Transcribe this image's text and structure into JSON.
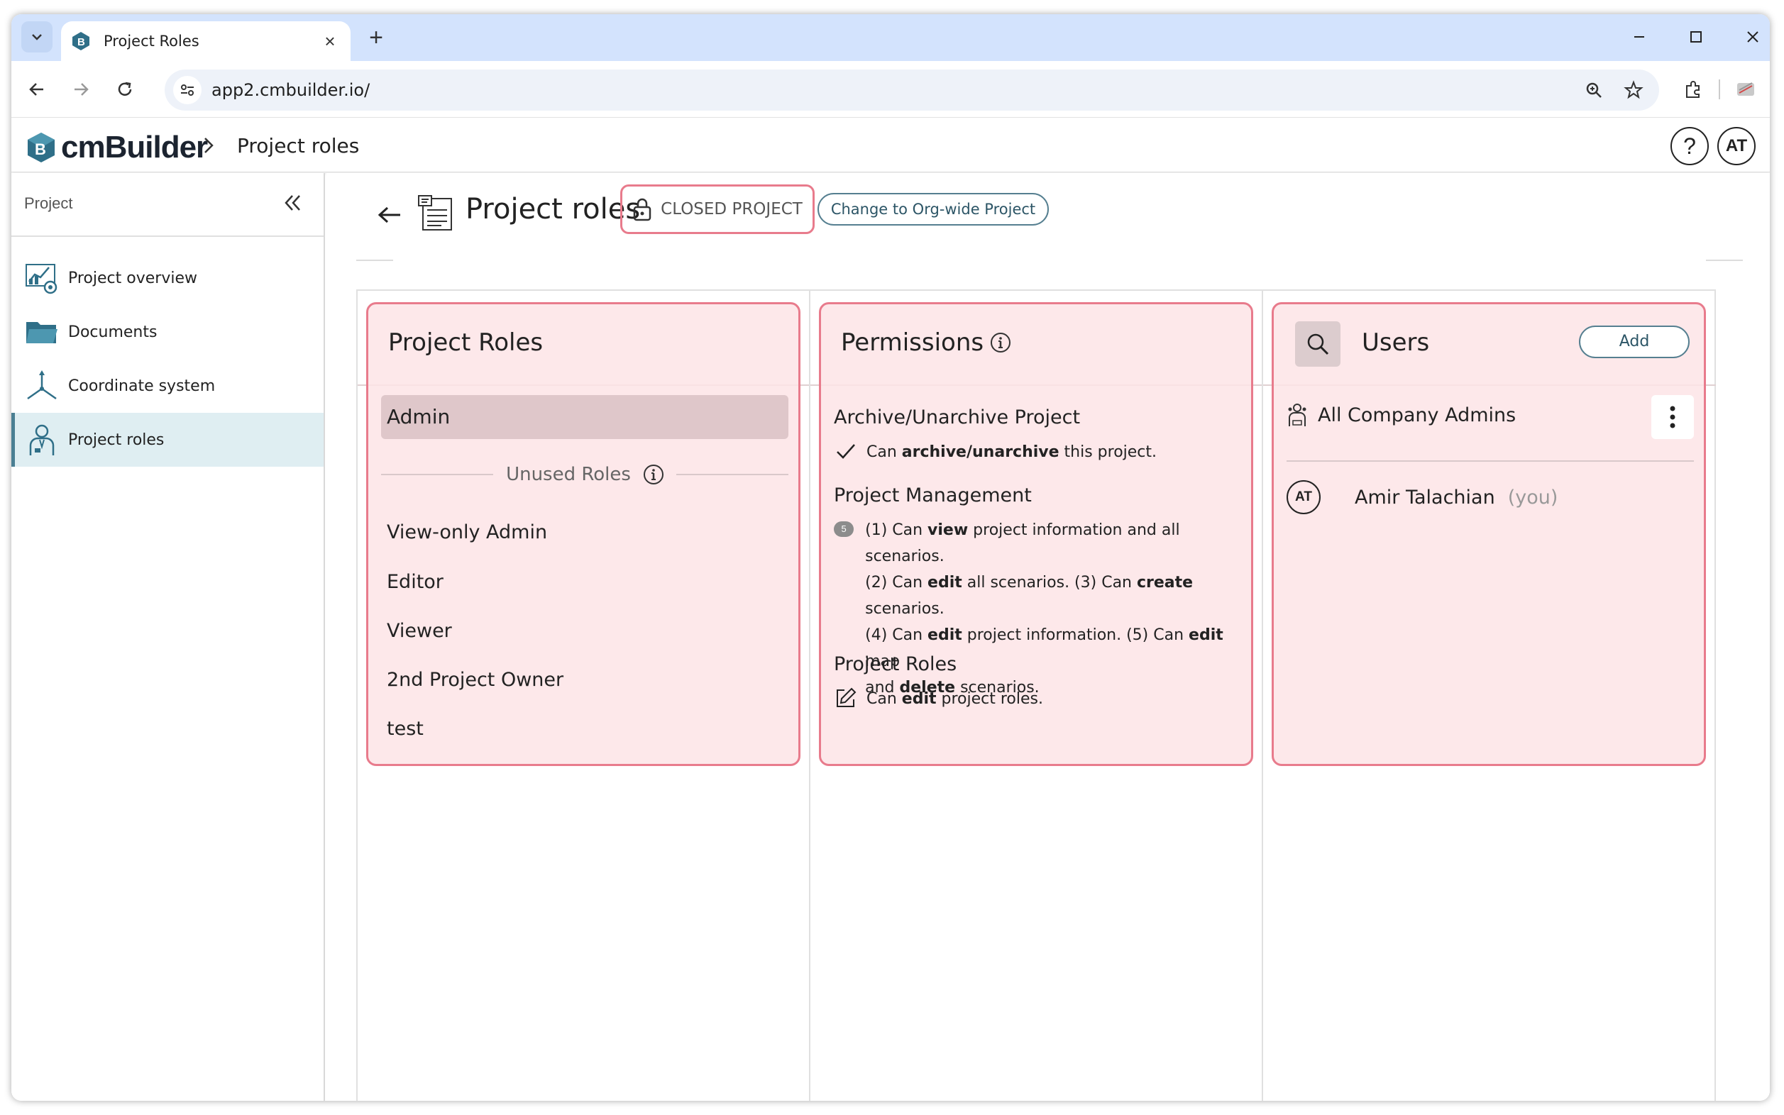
{
  "browser": {
    "tab_title": "Project Roles",
    "url": "app2.cmbuilder.io/",
    "new_tab": "+",
    "tab_close": "×"
  },
  "app": {
    "brand": "cmBuilder",
    "breadcrumb": "Project roles",
    "help": "?",
    "user_initials": "AT"
  },
  "sidebar": {
    "section": "Project",
    "items": [
      {
        "label": "Project overview",
        "icon": "project-overview-icon"
      },
      {
        "label": "Documents",
        "icon": "folder-icon"
      },
      {
        "label": "Coordinate system",
        "icon": "coordinate-axes-icon"
      },
      {
        "label": "Project roles",
        "icon": "person-badge-icon",
        "active": true
      }
    ]
  },
  "page": {
    "title": "Project roles",
    "badge": "CLOSED PROJECT",
    "change_button": "Change to Org-wide Project"
  },
  "roles": {
    "title": "Project Roles",
    "selected": "Admin",
    "unused_label": "Unused Roles",
    "unused": [
      "View-only Admin",
      "Editor",
      "Viewer",
      "2nd Project Owner",
      "test"
    ]
  },
  "permissions": {
    "title": "Permissions",
    "groups": [
      {
        "name": "Archive/Unarchive Project",
        "icon": "check-icon",
        "line": [
          "Can ",
          "archive/unarchive",
          " this project."
        ]
      },
      {
        "name": "Project Management",
        "badge": "5",
        "lines": [
          [
            "(1) Can ",
            "view",
            " project information and all scenarios."
          ],
          [
            "(2) Can ",
            "edit",
            " all scenarios. (3) Can ",
            "create",
            " scenarios."
          ],
          [
            "(4) Can ",
            "edit",
            " project information. (5) Can ",
            "edit",
            " map"
          ],
          [
            "and ",
            "delete",
            " scenarios."
          ]
        ]
      },
      {
        "name": "Project Roles",
        "icon": "edit-icon",
        "line": [
          "Can ",
          "edit",
          " project roles."
        ]
      }
    ]
  },
  "users": {
    "title": "Users",
    "add_button": "Add",
    "group": "All Company Admins",
    "user": {
      "initials": "AT",
      "name": "Amir Talachian",
      "suffix": "(you)"
    }
  },
  "colors": {
    "highlight_border": "#e87b8c",
    "highlight_fill": "#fde4e6",
    "accent": "#557f90",
    "tabstrip": "#d3e3fd"
  }
}
